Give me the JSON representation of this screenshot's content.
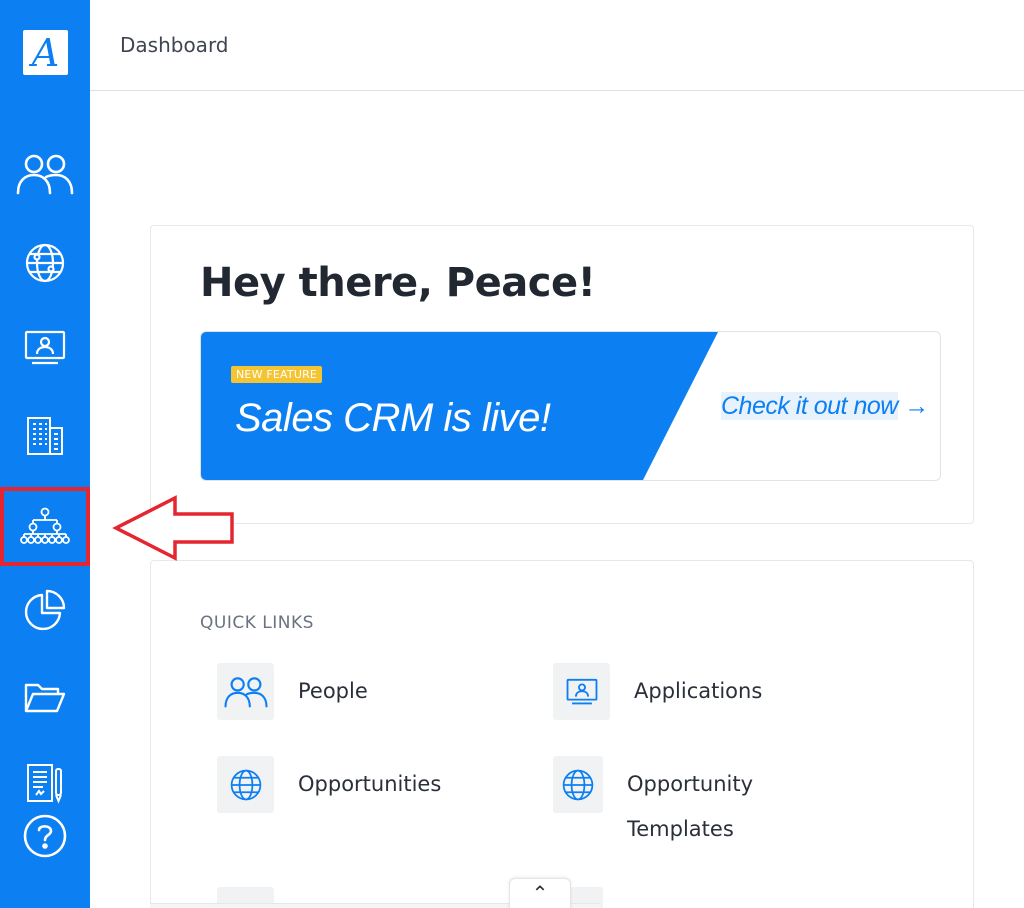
{
  "app": {
    "logo_letter": "A"
  },
  "header": {
    "title": "Dashboard"
  },
  "sidebar": {
    "items": [
      {
        "name": "people",
        "icon": "people-icon"
      },
      {
        "name": "opportunities",
        "icon": "globe-icon"
      },
      {
        "name": "applications",
        "icon": "applications-icon"
      },
      {
        "name": "organizations",
        "icon": "building-icon"
      },
      {
        "name": "org-chart",
        "icon": "hierarchy-icon",
        "highlighted": true
      },
      {
        "name": "reports",
        "icon": "pie-chart-icon"
      },
      {
        "name": "files",
        "icon": "folder-icon"
      },
      {
        "name": "documents",
        "icon": "document-icon"
      },
      {
        "name": "help",
        "icon": "help-icon"
      }
    ],
    "accent": "#0c7ff2",
    "highlight_color": "#e3262f"
  },
  "greeting": {
    "text": "Hey there, Peace!"
  },
  "banner": {
    "badge": "NEW FEATURE",
    "headline": "Sales CRM is live!",
    "cta": "Check it out now",
    "cta_arrow": "→"
  },
  "quick_links": {
    "label": "QUICK LINKS",
    "items": [
      {
        "label": "People",
        "icon": "people-icon"
      },
      {
        "label": "Applications",
        "icon": "applications-icon"
      },
      {
        "label": "Opportunities",
        "icon": "globe-icon"
      },
      {
        "label_line1": "Opportunity",
        "label_line2": "Templates",
        "icon": "globe-icon"
      }
    ]
  },
  "scroll": {
    "icon": "chevron-up-icon",
    "glyph": "⌃"
  }
}
